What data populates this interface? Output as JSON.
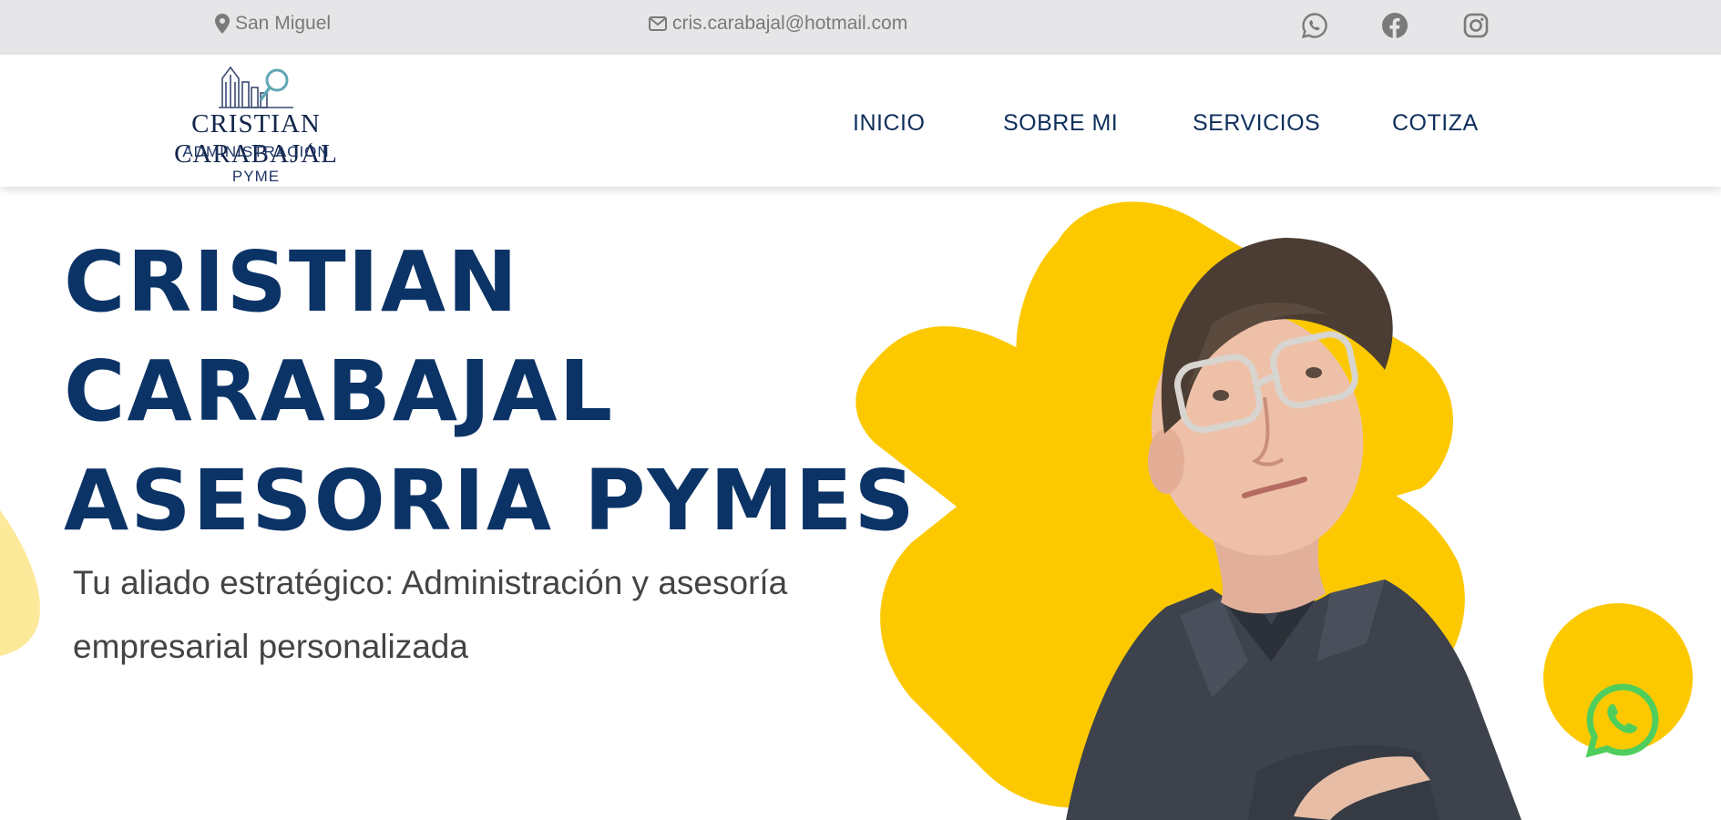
{
  "topbar": {
    "location": "San Miguel",
    "email": "cris.carabajal@hotmail.com",
    "social": [
      "whatsapp-icon",
      "facebook-icon",
      "instagram-icon"
    ]
  },
  "logo": {
    "name": "CRISTIAN CARABAJAL",
    "line1": "ADMINISTRACIÓN",
    "line2": "PYME"
  },
  "nav": {
    "items": [
      {
        "label": "INICIO"
      },
      {
        "label": "SOBRE MI"
      },
      {
        "label": "SERVICIOS"
      },
      {
        "label": "COTIZA"
      }
    ]
  },
  "hero": {
    "title_lines": [
      "CRISTIAN",
      "CARABAJAL",
      "ASESORIA PYMES"
    ],
    "subtitle": "Tu aliado estratégico: Administración y asesoría empresarial personalizada"
  },
  "colors": {
    "brand_navy": "#0b3366",
    "accent_yellow": "#fcc900",
    "topbar_bg": "#e6e6e8",
    "whatsapp_green": "#4fce5d"
  }
}
